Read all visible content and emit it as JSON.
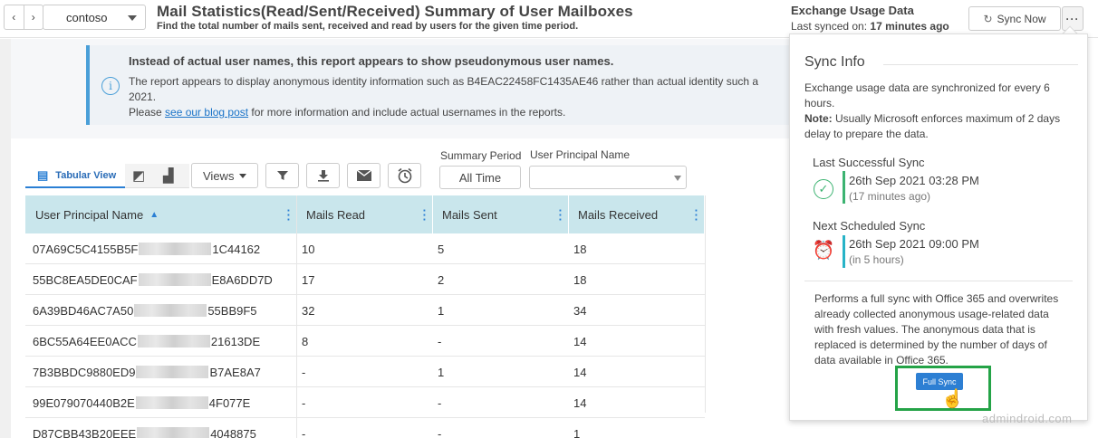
{
  "header": {
    "nav_prev": "‹",
    "nav_next": "›",
    "tenant": "contoso",
    "title": "Mail Statistics(Read/Sent/Received) Summary of User Mailboxes",
    "subtitle": "Find the total number of mails sent, received and read by users for the given time period.",
    "usage_title": "Exchange Usage Data",
    "last_synced_label": "Last synced on:",
    "last_synced_value": "17 minutes ago",
    "sync_now_label": "Sync Now",
    "more_label": "···"
  },
  "banner": {
    "title": "Instead of actual user names, this report appears to show pseudonymous user names.",
    "line1": "The report appears to display anonymous identity information such as B4EAC22458FC1435AE46 rather than actual identity such a",
    "line2": "2021.",
    "line3_pre": "Please ",
    "line3_link": "see our blog post",
    "line3_post": " for more information and include actual usernames in the reports."
  },
  "toolbar": {
    "tab_tabular": "Tabular View",
    "views_label": "Views",
    "summary_period_label": "Summary Period",
    "summary_period_value": "All Time",
    "upn_filter_label": "User Principal Name",
    "upn_filter_value": ""
  },
  "table": {
    "columns": [
      "User Principal Name",
      "Mails Read",
      "Mails Sent",
      "Mails Received"
    ],
    "rows": [
      {
        "upn_start": "07A69C5C4155B5F",
        "upn_end": "1C44162",
        "read": "10",
        "sent": "5",
        "received": "18"
      },
      {
        "upn_start": "55BC8EA5DE0CAF",
        "upn_end": "E8A6DD7D",
        "read": "17",
        "sent": "2",
        "received": "18"
      },
      {
        "upn_start": "6A39BD46AC7A50",
        "upn_end": "55BB9F5",
        "read": "32",
        "sent": "1",
        "received": "34"
      },
      {
        "upn_start": "6BC55A64EE0ACC",
        "upn_end": "21613DE",
        "read": "8",
        "sent": "-",
        "received": "14"
      },
      {
        "upn_start": "7B3BBDC9880ED9",
        "upn_end": "B7AE8A7",
        "read": "-",
        "sent": "1",
        "received": "14"
      },
      {
        "upn_start": "99E079070440B2E",
        "upn_end": "4F077E",
        "read": "-",
        "sent": "-",
        "received": "14"
      },
      {
        "upn_start": "D87CBB43B20EEE",
        "upn_end": "4048875",
        "read": "-",
        "sent": "-",
        "received": "1"
      }
    ]
  },
  "sync_info": {
    "title": "Sync Info",
    "intro": "Exchange usage data are synchronized for every 6 hours.",
    "note_label": "Note:",
    "note_text": " Usually Microsoft enforces maximum of 2 days delay to prepare the data.",
    "last_sync_title": "Last Successful Sync",
    "last_sync_date": "26th Sep 2021 03:28 PM",
    "last_sync_rel": "(17 minutes ago)",
    "next_sync_title": "Next Scheduled Sync",
    "next_sync_date": "26th Sep 2021 09:00 PM",
    "next_sync_rel": "(in 5 hours)",
    "full_sync_desc": "Performs a full sync with Office 365 and overwrites already collected anonymous usage-related data with fresh values. The anonymous data that is replaced is determined by the number of days of data available in Office 365.",
    "full_sync_label": "Full Sync"
  },
  "watermark": "admindroid.com",
  "colors": {
    "accent": "#2a7fd4",
    "table_header": "#c9e6ec",
    "success": "#3cb371",
    "highlight_frame": "#24a347"
  }
}
